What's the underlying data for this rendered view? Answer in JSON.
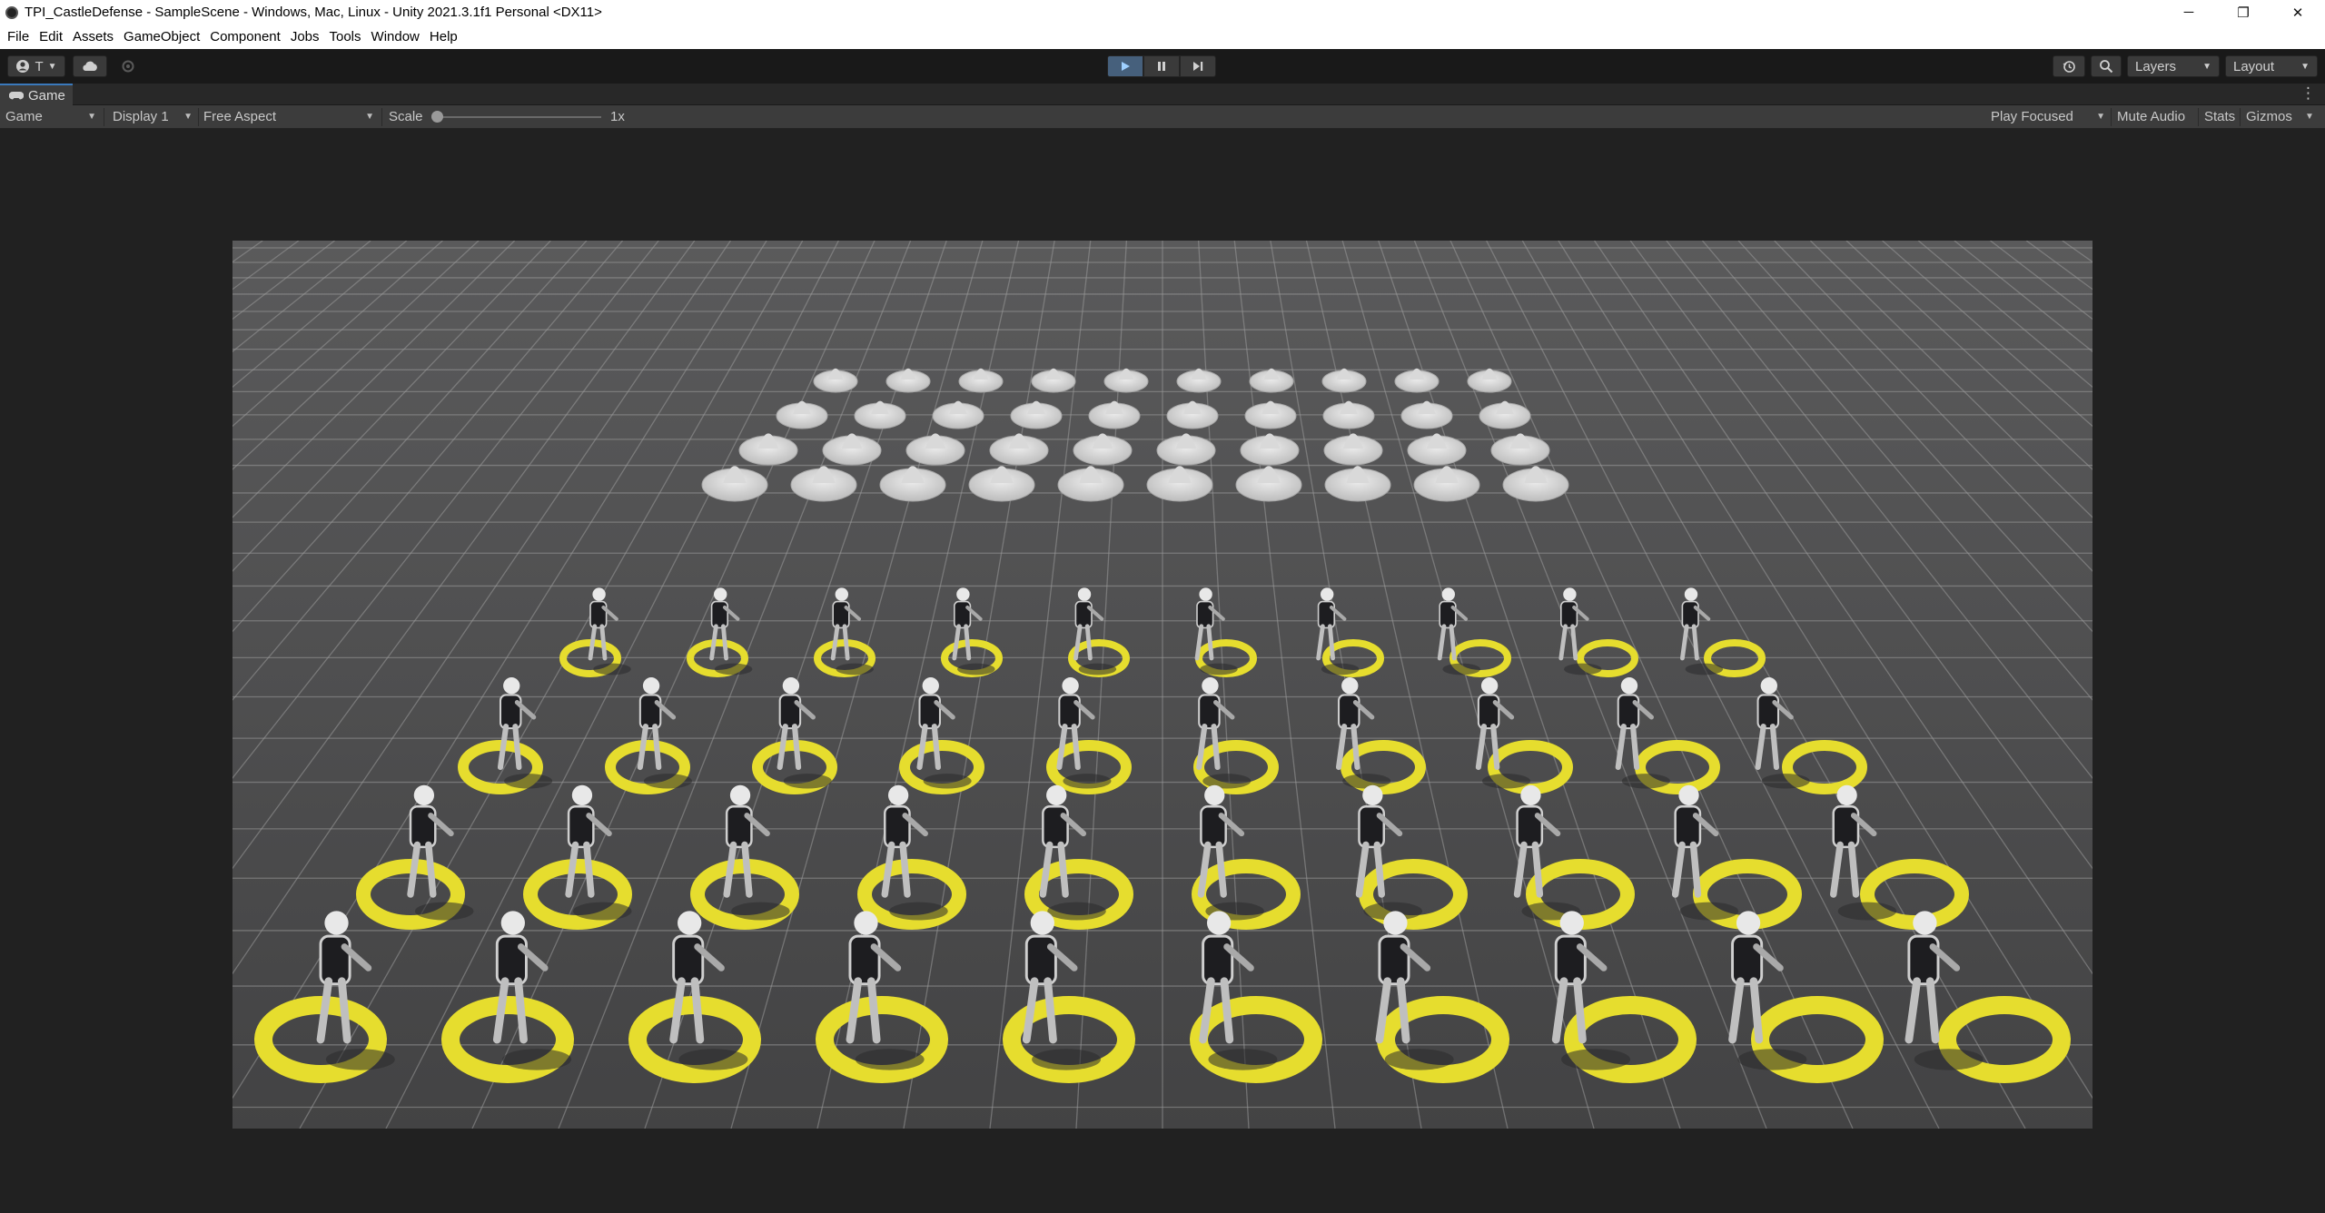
{
  "window": {
    "title": "TPI_CastleDefense - SampleScene - Windows, Mac, Linux - Unity 2021.3.1f1 Personal <DX11>",
    "controls": {
      "minimize": "─",
      "restore": "❐",
      "close": "✕"
    }
  },
  "menu": [
    "File",
    "Edit",
    "Assets",
    "GameObject",
    "Component",
    "Jobs",
    "Tools",
    "Window",
    "Help"
  ],
  "toolbar": {
    "account_label": "T",
    "layers_label": "Layers",
    "layout_label": "Layout",
    "play_state": "playing"
  },
  "tab": {
    "label": "Game"
  },
  "game_toolbar": {
    "view_mode": "Game",
    "display": "Display 1",
    "aspect": "Free Aspect",
    "scale_label": "Scale",
    "scale_value": "1x",
    "play_mode": "Play Focused",
    "mute_audio": "Mute Audio",
    "stats": "Stats",
    "gizmos": "Gizmos"
  },
  "scene": {
    "markers_rows": 4,
    "markers_cols": 10,
    "soldier_rows": 4,
    "soldier_cols": 10,
    "ring_color": "#e6dd2e",
    "marker_color": "#d9d9d9",
    "floor_color": "#4b4b4c",
    "grid_color": "#9a9a9a"
  },
  "colors": {
    "editor_bg": "#1f1f1f",
    "toolbar_bg": "#191919",
    "panel_bg": "#3c3c3c",
    "play_active": "#46607c"
  }
}
